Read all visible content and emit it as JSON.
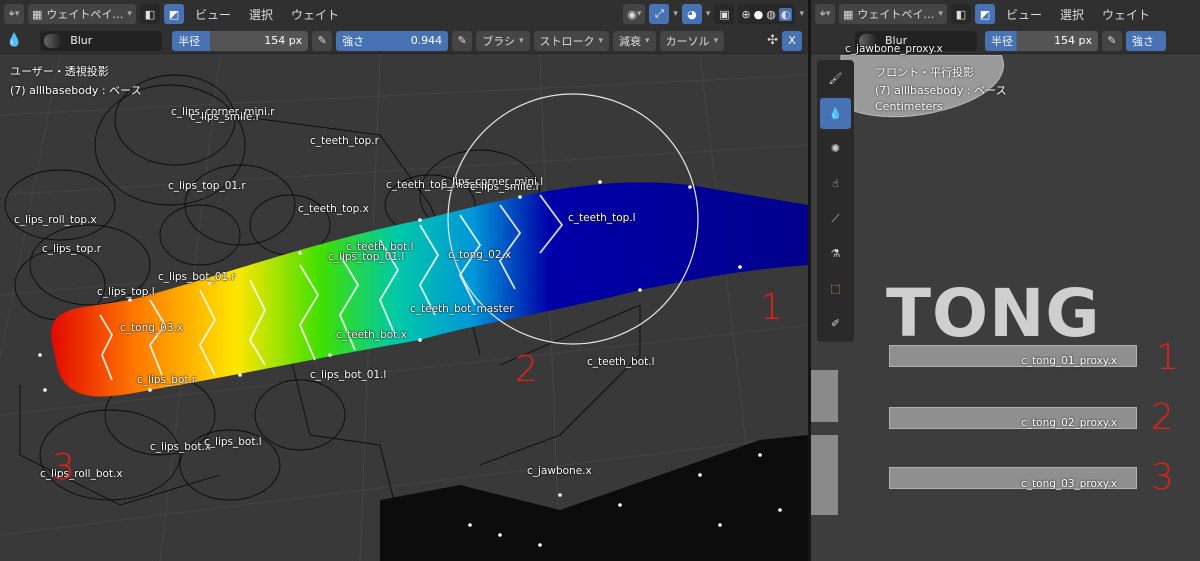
{
  "left": {
    "header": {
      "mode_label": "ウェイトペイ…",
      "menus": [
        "ビュー",
        "選択",
        "ウェイト"
      ]
    },
    "toolbar": {
      "brush_name": "Blur",
      "radius_label": "半径",
      "radius_value": "154 px",
      "strength_label": "強さ",
      "strength_value": "0.944",
      "dropdowns": [
        "ブラシ",
        "ストローク",
        "減衰",
        "カーソル"
      ],
      "x_label": "X"
    },
    "viewport": {
      "view_name": "ユーザー・透視投影",
      "object_info": "(7) alllbasebody : ベース",
      "bones": [
        "c_lips_corner_mini.r",
        "c_lips_smile.r",
        "c_teeth_top.r",
        "c_lips_top_01.r",
        "c_teeth_top_master",
        "c_lips_corner_mini.l",
        "c_lips_smile.l",
        "c_teeth_top.x",
        "c_teeth_top.l",
        "c_lips_roll_top.x",
        "c_lips_top.r",
        "c_teeth_bot.l",
        "c_lips_top_01.l",
        "c_tong_02.x",
        "c_lips_bot_01.r",
        "c_lips_top.l",
        "c_teeth_bot_master",
        "c_tong_03.x",
        "c_teeth_bot.x",
        "c_lips_bot.r",
        "c_lips_bot_01.l",
        "c_teeth_bot.l",
        "c_lips_bot.x",
        "c_lips_bot.l",
        "c_lips_roll_bot.x",
        "c_jawbone.x"
      ],
      "annotations": [
        "1",
        "2",
        "3"
      ]
    }
  },
  "right": {
    "header": {
      "mode_label": "ウェイトペイ…",
      "menus": [
        "ビュー",
        "選択",
        "ウェイト"
      ]
    },
    "toolbar": {
      "brush_name": "Blur",
      "radius_label": "半径",
      "radius_value": "154 px",
      "strength_label": "強さ"
    },
    "viewport": {
      "partial_label": "c_jawbone_proxy.x",
      "view_name": "フロント・平行投影",
      "object_info": "(7) alllbasebody : ベース",
      "units": "Centimeters",
      "big_text": "TONG",
      "proxies": [
        "c_tong_01_proxy.x",
        "c_tong_02_proxy.x",
        "c_tong_03_proxy.x"
      ],
      "annotations": [
        "1",
        "2",
        "3"
      ]
    }
  },
  "colors": {
    "accent": "#4772b3",
    "annotation": "#e0201a"
  },
  "icons": [
    "view-transform-icon",
    "mode-icon",
    "xray-icon",
    "overlay-icon",
    "gizmo-icon",
    "draw-brush-icon",
    "blur-brush-icon",
    "average-brush-icon",
    "smear-brush-icon",
    "gradient-icon",
    "sample-weight-icon",
    "select-box-icon",
    "annotate-icon",
    "symmetry-icon"
  ]
}
